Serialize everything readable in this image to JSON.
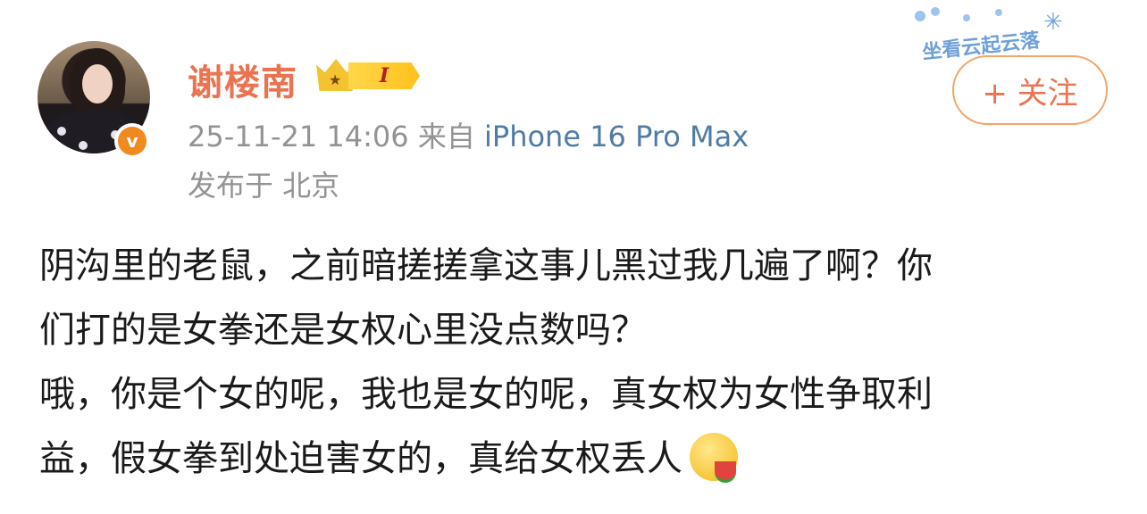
{
  "user": {
    "name": "谢楼南",
    "member_level": "I",
    "verified_mark": "v"
  },
  "meta": {
    "datetime": "25-11-21 14:06",
    "source_prefix": "来自",
    "device": "iPhone 16 Pro Max",
    "location": "发布于 北京"
  },
  "decoration": {
    "text": "坐看云起云落"
  },
  "follow_button": {
    "label": "+ 关注"
  },
  "post": {
    "lines": [
      "阴沟里的老鼠，之前暗搓搓拿这事儿黑过我几遍了啊？你",
      "们打的是女拳还是女权心里没点数吗？",
      "哦，你是个女的呢，我也是女的呢，真女权为女性争取利",
      "益，假女拳到处迫害女的，真给女权丢人"
    ]
  },
  "icons": {
    "avatar": "user-avatar",
    "verified": "verified-badge-icon",
    "crown": "crown-icon",
    "emoji": "eating-watermelon-emoji"
  },
  "colors": {
    "name": "#eb7350",
    "device_link": "#4f7ba5",
    "meta_gray": "#939393",
    "follow_border": "#f3a46a"
  }
}
